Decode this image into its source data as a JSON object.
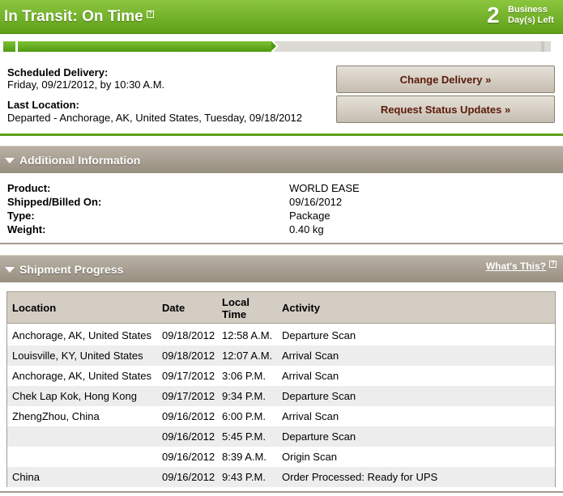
{
  "status": {
    "title": "In Transit: On Time",
    "help_icon": "?",
    "days_left_number": "2",
    "days_left_line1": "Business",
    "days_left_line2": "Day(s) Left"
  },
  "progress": {
    "fraction_complete": 0.49
  },
  "delivery": {
    "scheduled_label": "Scheduled Delivery:",
    "scheduled_value": "Friday, 09/21/2012, by 10:30 A.M.",
    "last_location_label": "Last Location:",
    "last_location_value": "Departed - Anchorage, AK, United States, Tuesday, 09/18/2012"
  },
  "actions": {
    "change_delivery": "Change Delivery »",
    "request_updates": "Request Status Updates »"
  },
  "additional_info": {
    "title": "Additional Information",
    "rows": [
      {
        "label": "Product:",
        "value": "WORLD EASE"
      },
      {
        "label": "Shipped/Billed On:",
        "value": "09/16/2012"
      },
      {
        "label": "Type:",
        "value": "Package"
      },
      {
        "label": "Weight:",
        "value": "0.40 kg"
      }
    ]
  },
  "shipment_progress": {
    "title": "Shipment Progress",
    "whats_this": "What's This?",
    "columns": {
      "location": "Location",
      "date": "Date",
      "time_line1": "Local",
      "time_line2": "Time",
      "activity": "Activity"
    },
    "rows": [
      {
        "location": "Anchorage, AK, United States",
        "date": "09/18/2012",
        "time": "12:58 A.M.",
        "activity": "Departure Scan"
      },
      {
        "location": "Louisville, KY, United States",
        "date": "09/18/2012",
        "time": "12:07 A.M.",
        "activity": "Arrival Scan"
      },
      {
        "location": "Anchorage, AK, United States",
        "date": "09/17/2012",
        "time": "3:06 P.M.",
        "activity": "Arrival Scan"
      },
      {
        "location": "Chek Lap Kok, Hong Kong",
        "date": "09/17/2012",
        "time": "9:34 P.M.",
        "activity": "Departure Scan"
      },
      {
        "location": "ZhengZhou, China",
        "date": "09/16/2012",
        "time": "6:00 P.M.",
        "activity": "Arrival Scan"
      },
      {
        "location": "",
        "date": "09/16/2012",
        "time": "5:45 P.M.",
        "activity": "Departure Scan"
      },
      {
        "location": "",
        "date": "09/16/2012",
        "time": "8:39 A.M.",
        "activity": "Origin Scan"
      },
      {
        "location": "China",
        "date": "09/16/2012",
        "time": "9:43 P.M.",
        "activity": "Order Processed: Ready for UPS"
      }
    ]
  },
  "colors": {
    "brand_green": "#5ea018",
    "button_text": "#5a1a0a",
    "header_tan": "#a59c8e"
  }
}
